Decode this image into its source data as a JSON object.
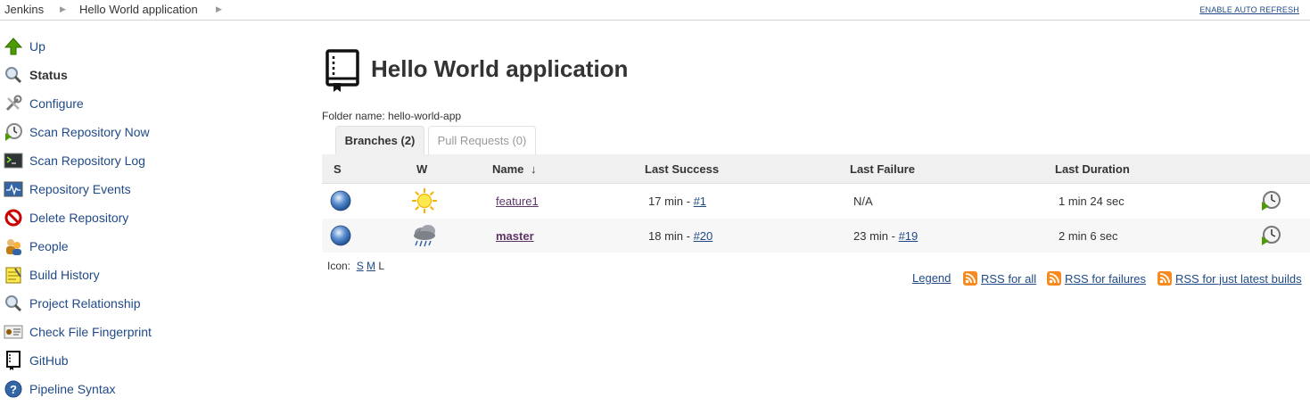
{
  "breadcrumbs": [
    "Jenkins",
    "Hello World application"
  ],
  "header": {
    "auto_refresh": "ENABLE AUTO REFRESH"
  },
  "sidebar": {
    "items": [
      {
        "label": "Up",
        "icon": "up-arrow-icon"
      },
      {
        "label": "Status",
        "icon": "magnifier-icon"
      },
      {
        "label": "Configure",
        "icon": "wrench-icon"
      },
      {
        "label": "Scan Repository Now",
        "icon": "clock-play-icon"
      },
      {
        "label": "Scan Repository Log",
        "icon": "terminal-icon"
      },
      {
        "label": "Repository Events",
        "icon": "monitor-icon"
      },
      {
        "label": "Delete Repository",
        "icon": "no-entry-icon"
      },
      {
        "label": "People",
        "icon": "people-icon"
      },
      {
        "label": "Build History",
        "icon": "notepad-icon"
      },
      {
        "label": "Project Relationship",
        "icon": "magnifier-icon"
      },
      {
        "label": "Check File Fingerprint",
        "icon": "fingerprint-card-icon"
      },
      {
        "label": "GitHub",
        "icon": "repo-book-icon"
      },
      {
        "label": "Pipeline Syntax",
        "icon": "help-icon"
      }
    ]
  },
  "main": {
    "title": "Hello World application",
    "folder_name": "Folder name: hello-world-app",
    "tabs": [
      {
        "label": "Branches (2)",
        "active": true
      },
      {
        "label": "Pull Requests (0)",
        "active": false
      }
    ],
    "table": {
      "columns": [
        "S",
        "W",
        "Name",
        "Last Success",
        "Last Failure",
        "Last Duration"
      ],
      "sort_indicator": "↓",
      "rows": [
        {
          "status": "blue",
          "weather": "sunny",
          "name": "feature1",
          "last_success_time": "17 min - ",
          "last_success_build": "#1",
          "last_failure_time": "N/A",
          "last_failure_build": "",
          "last_duration": "1 min 24 sec"
        },
        {
          "status": "blue",
          "weather": "raining",
          "name": "master",
          "last_success_time": "18 min - ",
          "last_success_build": "#20",
          "last_failure_time": "23 min - ",
          "last_failure_build": "#19",
          "last_duration": "2 min 6 sec"
        }
      ]
    },
    "icon_sizes": {
      "label": "Icon:",
      "small": "S",
      "medium": "M",
      "large": "L"
    },
    "footer_links": {
      "legend": "Legend",
      "rss_all": "RSS for all",
      "rss_failures": "RSS for failures",
      "rss_latest": "RSS for just latest builds"
    }
  },
  "colors": {
    "link": "#204a87",
    "visited_link": "#5c3566",
    "header_bg": "#f0f0f0",
    "rss_orange": "#f78a1e"
  }
}
